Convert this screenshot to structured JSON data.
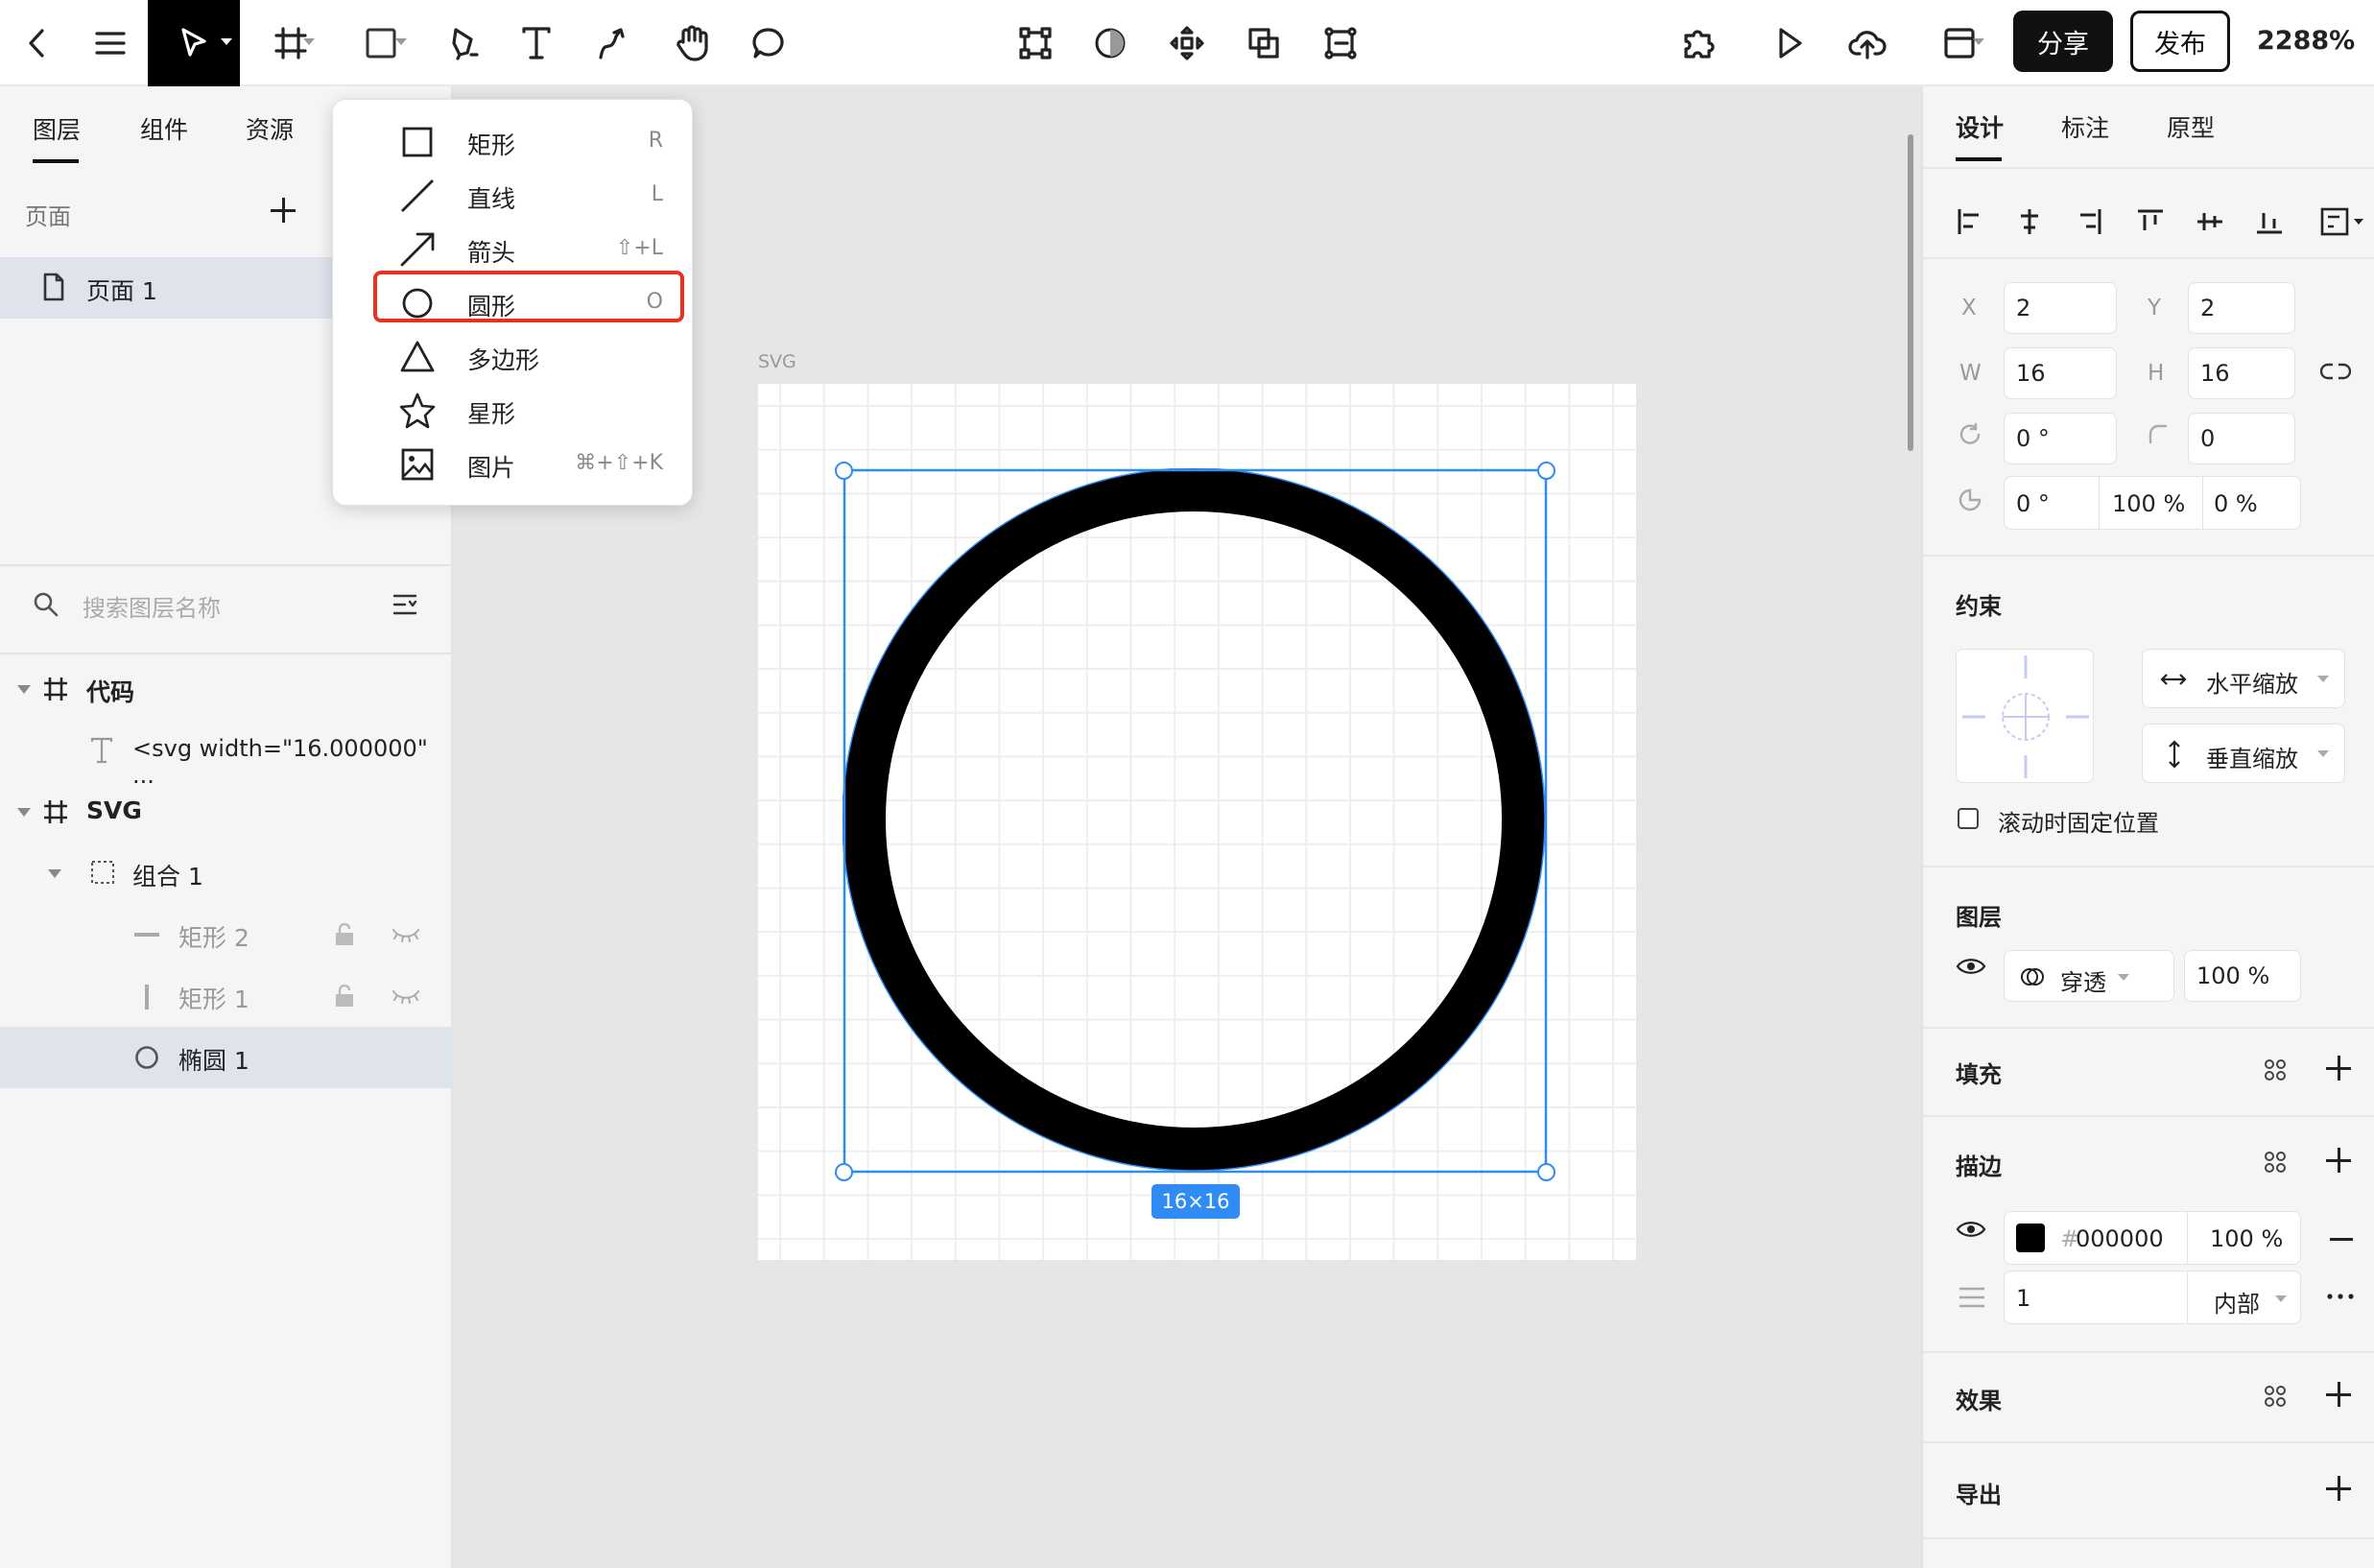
{
  "toolbar": {
    "share_label": "分享",
    "publish_label": "发布",
    "zoom": "2288%"
  },
  "left_panel": {
    "tabs": [
      "图层",
      "组件",
      "资源"
    ],
    "pages_title": "页面",
    "page_item": "页面 1",
    "search_placeholder": "搜索图层名称",
    "layers": [
      {
        "label": "代码",
        "bold": true
      },
      {
        "label": "<svg width=\"16.000000\" ..."
      },
      {
        "label": "SVG",
        "bold": true
      },
      {
        "label": "组合 1"
      },
      {
        "label": "矩形 2"
      },
      {
        "label": "矩形 1"
      },
      {
        "label": "椭圆 1"
      }
    ]
  },
  "menu": {
    "items": [
      {
        "label": "矩形",
        "shortcut": "R",
        "icon": "rect-icon"
      },
      {
        "label": "直线",
        "shortcut": "L",
        "icon": "line-icon"
      },
      {
        "label": "箭头",
        "shortcut": "⇧+L",
        "icon": "arrow-icon"
      },
      {
        "label": "圆形",
        "shortcut": "O",
        "icon": "circle-icon",
        "highlighted": true
      },
      {
        "label": "多边形",
        "shortcut": "",
        "icon": "triangle-icon"
      },
      {
        "label": "星形",
        "shortcut": "",
        "icon": "star-icon"
      },
      {
        "label": "图片",
        "shortcut": "⌘+⇧+K",
        "icon": "image-icon"
      }
    ]
  },
  "canvas": {
    "frame_label": "SVG",
    "size_badge": "16×16"
  },
  "right_panel": {
    "tabs": [
      "设计",
      "标注",
      "原型"
    ],
    "x_label": "X",
    "x": "2",
    "y_label": "Y",
    "y": "2",
    "w_label": "W",
    "w": "16",
    "h_label": "H",
    "h": "16",
    "rotation": "0 °",
    "radius": "0",
    "arc_start": "0 °",
    "arc_sweep": "100 %",
    "arc_ratio": "0 %",
    "constraints_title": "约束",
    "horizontal_constraint": "水平缩放",
    "vertical_constraint": "垂直缩放",
    "fix_scroll_label": "滚动时固定位置",
    "layer_title": "图层",
    "blend_mode": "穿透",
    "layer_opacity": "100 %",
    "fill_title": "填充",
    "stroke_title": "描边",
    "stroke_color_hash": "#",
    "stroke_color": "000000",
    "stroke_opacity": "100 %",
    "stroke_width": "1",
    "stroke_position": "内部",
    "effects_title": "效果",
    "export_title": "导出"
  },
  "colors": {
    "accent": "#2f8cf5",
    "highlight_border": "#e8321f",
    "selected_row": "#dfe3ec",
    "stroke_swatch": "#000000"
  }
}
